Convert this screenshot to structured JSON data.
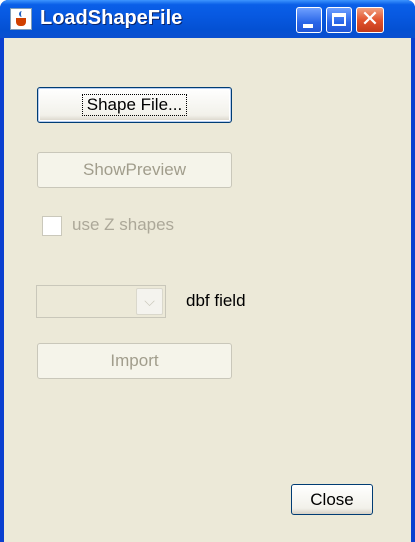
{
  "window": {
    "title": "LoadShapeFile",
    "close_glyph": "✕",
    "icons": [
      "java-cup-icon",
      "minimize-icon",
      "maximize-icon",
      "close-icon"
    ]
  },
  "buttons": {
    "shape_file": "Shape File...",
    "show_preview": "ShowPreview",
    "import": "Import",
    "close": "Close"
  },
  "checkbox": {
    "label": "use Z shapes",
    "checked": false,
    "enabled": false
  },
  "dbf": {
    "selected": "",
    "label": "dbf field",
    "arrow": "⌵"
  },
  "colors": {
    "titlebar": "#0a5fe8",
    "client_bg": "#ece9d8",
    "disabled_text": "#aca899",
    "close_button": "#e2542e"
  }
}
